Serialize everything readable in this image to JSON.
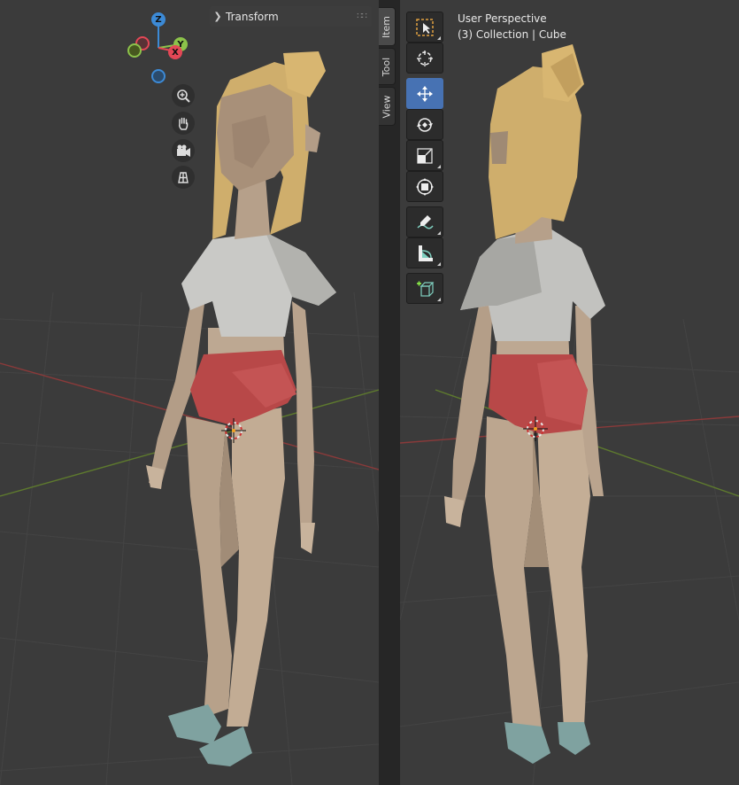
{
  "viewport_left": {
    "panel_header": {
      "label": "Transform"
    },
    "gizmo": {
      "axes": {
        "z": "Z",
        "y": "Y",
        "x": "X"
      }
    },
    "nav_buttons": [
      {
        "name": "zoom-icon"
      },
      {
        "name": "pan-hand-icon"
      },
      {
        "name": "camera-icon"
      },
      {
        "name": "grid-ortho-icon"
      }
    ]
  },
  "sidebar_tabs": [
    {
      "label": "Item",
      "active": true
    },
    {
      "label": "Tool",
      "active": false
    },
    {
      "label": "View",
      "active": false
    }
  ],
  "viewport_right": {
    "overlay": {
      "perspective": "User Perspective",
      "collection": "(3) Collection | Cube"
    },
    "toolbar": [
      {
        "name": "select-box-icon",
        "active": false
      },
      {
        "name": "cursor-icon",
        "active": false
      },
      {
        "name": "move-icon",
        "active": true
      },
      {
        "name": "rotate-icon",
        "active": false
      },
      {
        "name": "scale-icon",
        "active": false
      },
      {
        "name": "transform-icon",
        "active": false
      },
      {
        "name": "annotate-icon",
        "active": false
      },
      {
        "name": "measure-icon",
        "active": false
      },
      {
        "name": "add-cube-icon",
        "active": false
      }
    ]
  },
  "colors": {
    "viewport_bg": "#3b3b3b",
    "active_tool": "#4772b3",
    "axis_x": "#e34756",
    "axis_y": "#8cc24a",
    "axis_z": "#3c8ad6",
    "shirt": "#c9c9c6",
    "shorts": "#b84848",
    "skin": "#b9a48e",
    "hair": "#cfae6c",
    "sandals": "#7fa2a0"
  }
}
